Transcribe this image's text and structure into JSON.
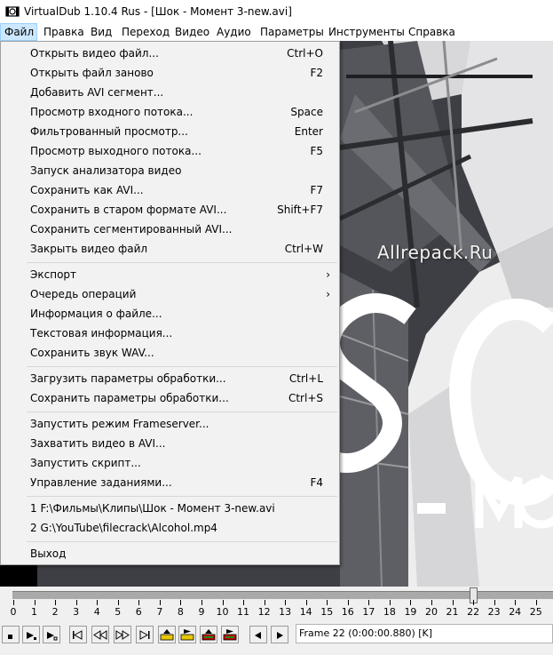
{
  "window": {
    "title": "VirtualDub 1.10.4 Rus - [Шок - Момент 3-new.avi]"
  },
  "menubar": [
    {
      "label": "Файл"
    },
    {
      "label": "Правка"
    },
    {
      "label": "Вид"
    },
    {
      "label": "Переход"
    },
    {
      "label": "Видео"
    },
    {
      "label": "Аудио"
    },
    {
      "label": "Параметры"
    },
    {
      "label": "Инструменты"
    },
    {
      "label": "Справка"
    }
  ],
  "file_menu": {
    "items": [
      {
        "label": "Открыть видео файл...",
        "shortcut": "Ctrl+O"
      },
      {
        "label": "Открыть файл заново",
        "shortcut": "F2"
      },
      {
        "label": "Добавить AVI сегмент...",
        "shortcut": ""
      },
      {
        "label": "Просмотр входного потока...",
        "shortcut": "Space"
      },
      {
        "label": "Фильтрованный просмотр...",
        "shortcut": "Enter"
      },
      {
        "label": "Просмотр выходного потока...",
        "shortcut": "F5"
      },
      {
        "label": "Запуск анализатора видео",
        "shortcut": ""
      },
      {
        "label": "Сохранить как AVI...",
        "shortcut": "F7"
      },
      {
        "label": "Сохранить в старом формате AVI...",
        "shortcut": "Shift+F7"
      },
      {
        "label": "Сохранить сегментированный AVI...",
        "shortcut": ""
      },
      {
        "label": "Закрыть видео файл",
        "shortcut": "Ctrl+W"
      },
      {
        "label": "Экспорт",
        "shortcut": ""
      },
      {
        "label": "Очередь операций",
        "shortcut": ""
      },
      {
        "label": "Информация о файле...",
        "shortcut": ""
      },
      {
        "label": "Текстовая информация...",
        "shortcut": ""
      },
      {
        "label": "Сохранить звук WAV...",
        "shortcut": ""
      },
      {
        "label": "Загрузить параметры обработки...",
        "shortcut": "Ctrl+L"
      },
      {
        "label": "Сохранить параметры обработки...",
        "shortcut": "Ctrl+S"
      },
      {
        "label": "Запустить режим Frameserver...",
        "shortcut": ""
      },
      {
        "label": "Захватить видео в AVI...",
        "shortcut": ""
      },
      {
        "label": "Запустить скрипт...",
        "shortcut": ""
      },
      {
        "label": "Управление заданиями...",
        "shortcut": "F4"
      },
      {
        "label": "1 F:\\Фильмы\\Клипы\\Шок - Момент 3-new.avi",
        "shortcut": ""
      },
      {
        "label": "2 G:\\YouTube\\filecrack\\Alcohol.mp4",
        "shortcut": ""
      },
      {
        "label": "Выход",
        "shortcut": ""
      }
    ]
  },
  "video": {
    "watermark": "Allrepack.Ru"
  },
  "timeline": {
    "ticks": [
      "0",
      "1",
      "2",
      "3",
      "4",
      "5",
      "6",
      "7",
      "8",
      "9",
      "10",
      "11",
      "12",
      "13",
      "14",
      "15",
      "16",
      "17",
      "18",
      "19",
      "20",
      "21",
      "22",
      "23",
      "24",
      "25"
    ],
    "current_frame": 22,
    "max_frame": 25
  },
  "status": {
    "text": "Frame 22 (0:00:00.880) [K]"
  }
}
